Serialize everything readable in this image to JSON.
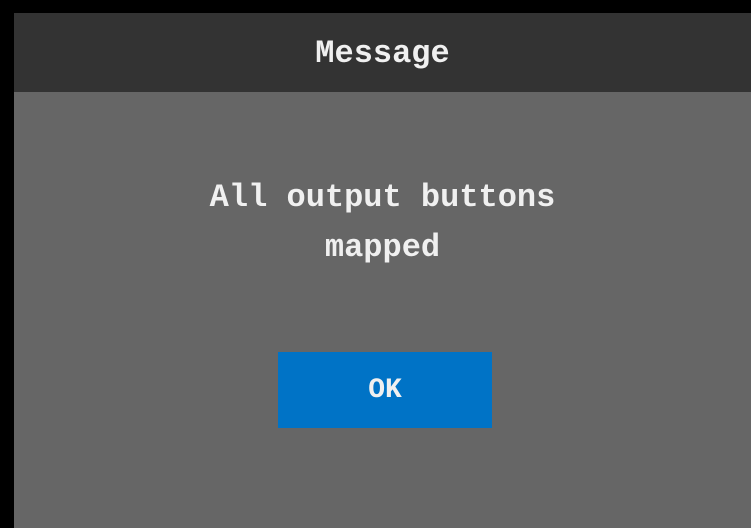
{
  "dialog": {
    "title": "Message",
    "message_line1": "All output buttons",
    "message_line2": "mapped",
    "ok_label": "OK"
  },
  "colors": {
    "background": "#000000",
    "dialog_body": "#666666",
    "title_bar": "#333333",
    "button": "#0073c6",
    "text": "#f0f0f0"
  }
}
